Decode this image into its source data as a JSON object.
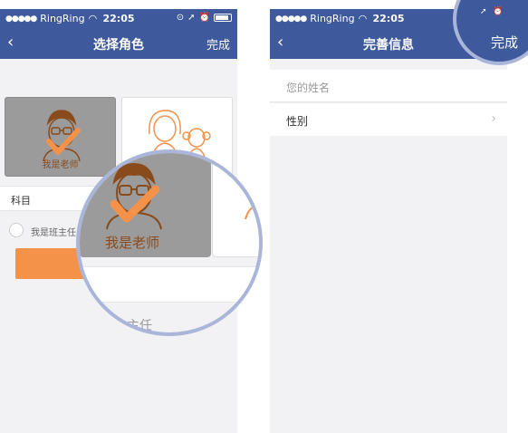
{
  "left_screen": {
    "status": {
      "carrier": "RingRing",
      "time": "22:05"
    },
    "nav": {
      "back_icon": "chevron-left-icon",
      "title": "选择角色",
      "done_label": "完成"
    },
    "role_cards": [
      {
        "label": "我是老师",
        "selected": true
      },
      {
        "label": "",
        "selected": false
      }
    ],
    "subject_label": "科目",
    "head_teacher_label": "我是班主任",
    "magnifier": {
      "teacher_label": "我是老师",
      "head_teacher_partial": "主任"
    }
  },
  "right_screen": {
    "status": {
      "carrier": "RingRing",
      "time": "22:05"
    },
    "nav": {
      "back_icon": "chevron-left-icon",
      "title": "完善信息",
      "done_label": "完成"
    },
    "name_placeholder": "您的姓名",
    "gender_label": "性别",
    "gender_chevron": "›",
    "corner_magnifier": {
      "done_label": "完成"
    }
  },
  "colors": {
    "brand": "#3f5a9c",
    "accent": "#f5924a",
    "magnifier_ring": "#aab6d9"
  }
}
